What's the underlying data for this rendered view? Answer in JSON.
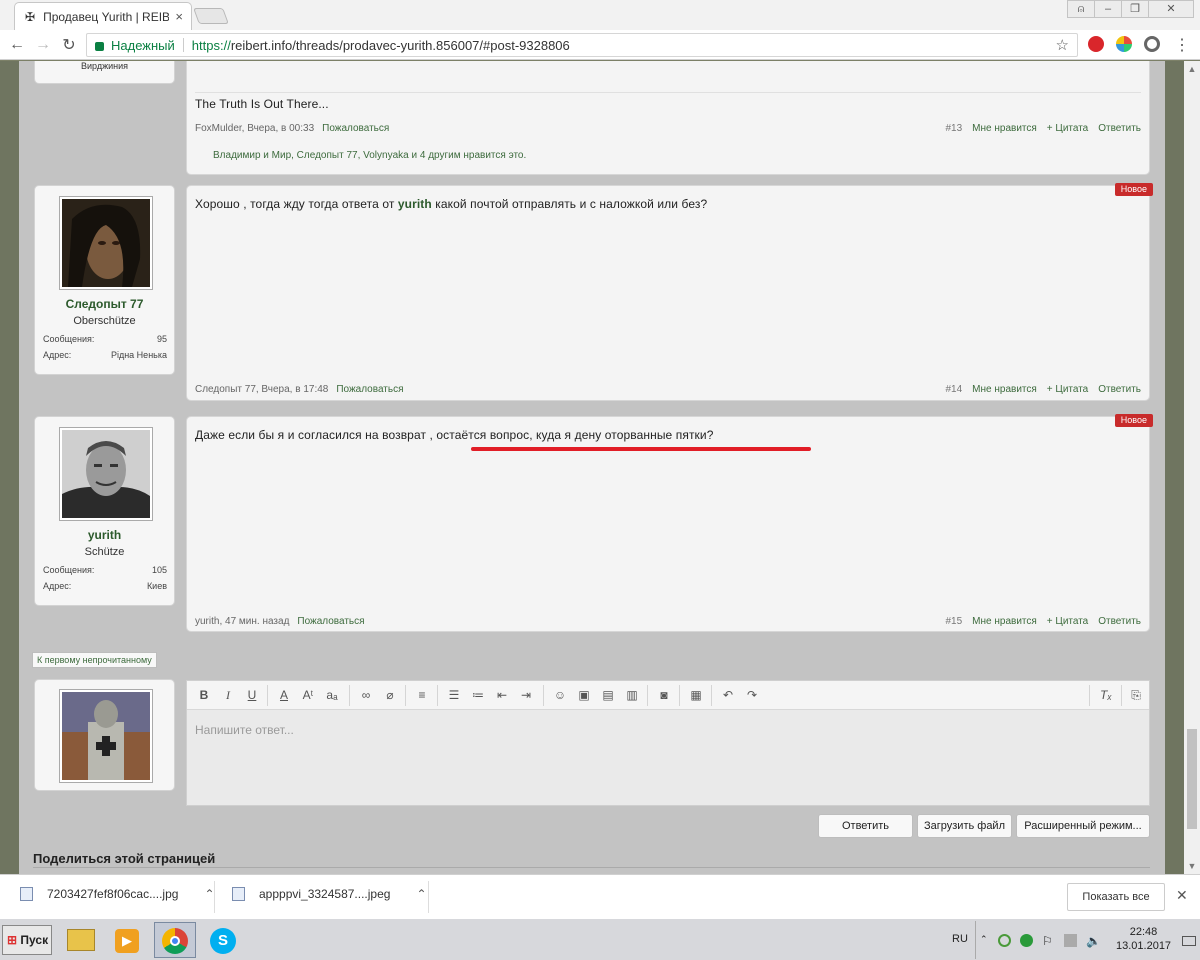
{
  "browser": {
    "tab_title": "Продавец Yurith | REIBE",
    "secure_label": "Надежный",
    "url_scheme": "https://",
    "url_rest": "reibert.info/threads/prodavec-yurith.856007/#post-9328806"
  },
  "prev_post": {
    "location": "Вирджиния",
    "text": "The Truth Is Out There...",
    "author_time": "FoxMulder, Вчера, в 00:33",
    "report": "Пожаловаться",
    "num": "#13",
    "like": "Мне нравится",
    "quote": "+ Цитата",
    "reply": "Ответить",
    "likes_line": "Владимир и Мир, Следопыт 77, Volynyaka и 4 другим нравится это."
  },
  "posts": [
    {
      "username": "Следопыт 77",
      "user_title": "Oberschütze",
      "messages_label": "Сообщения:",
      "messages_value": "95",
      "address_label": "Адрес:",
      "address_value": "Рідна Ненька",
      "badge": "Новое",
      "text_before": "Хорошо , тогда жду тогда ответа от ",
      "text_bold": "yurith",
      "text_after": " какой почтой отправлять и с наложкой или без?",
      "author_time": "Следопыт 77, Вчера, в 17:48",
      "report": "Пожаловаться",
      "num": "#14",
      "like": "Мне нравится",
      "quote": "+ Цитата",
      "reply": "Ответить"
    },
    {
      "username": "yurith",
      "user_title": "Schütze",
      "messages_label": "Сообщения:",
      "messages_value": "105",
      "address_label": "Адрес:",
      "address_value": "Киев",
      "badge": "Новое",
      "text": "Даже если бы я и согласился на возврат , остаётся вопрос, куда я дену оторванные пятки?",
      "author_time": "yurith, 47 мин. назад",
      "report": "Пожаловаться",
      "num": "#15",
      "like": "Мне нравится",
      "quote": "+ Цитата",
      "reply": "Ответить"
    }
  ],
  "first_unread": "К первому непрочитанному",
  "editor": {
    "placeholder": "Напишите ответ...",
    "reply_button": "Ответить",
    "upload_button": "Загрузить файл",
    "advanced_button": "Расширенный режим..."
  },
  "share_title": "Поделиться этой страницей",
  "downloads": {
    "file1": "7203427fef8f06cac....jpg",
    "file2": "appppvi_3324587....jpeg",
    "show_all": "Показать все"
  },
  "taskbar": {
    "start": "Пуск",
    "lang": "RU",
    "time": "22:48",
    "date": "13.01.2017"
  },
  "colors": {
    "username_green": "#2c5a2c",
    "new_badge": "#c82b2b",
    "highlight_line": "#e11d26",
    "secure_green": "#0b8043"
  }
}
